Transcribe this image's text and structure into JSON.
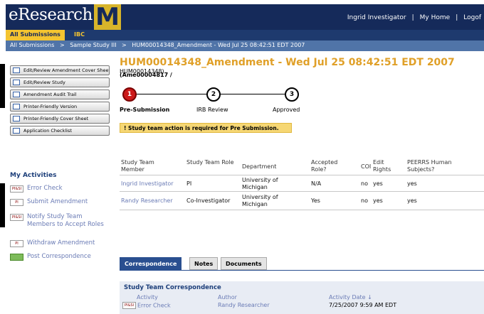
{
  "header": {
    "logo_text": "eResearch",
    "logo_mark": "M",
    "user_name": "Ingrid Investigator",
    "separator": "|",
    "my_home": "My Home",
    "logoff": "Logof"
  },
  "tabbar": {
    "all_submissions": "All Submissions",
    "irb": "IBC"
  },
  "breadcrumb": {
    "items": [
      "All Submissions",
      ">",
      "Sample Study III",
      ">",
      "HUM00014348_Amendment - Wed Jul 25 08:42:51 EDT 2007"
    ]
  },
  "sidebar": {
    "buttons": [
      "Edit/Review Amendment Cover Sheet",
      "Edit/Review Study",
      "Amendment Audit Trail",
      "Printer-Friendly Version",
      "Printer-Friendly Cover Sheet",
      "Application Checklist"
    ],
    "activities_title": "My Activities",
    "activities": [
      {
        "badge": "PI&SI",
        "label": "Error Check"
      },
      {
        "badge": "PI",
        "label": "Submit Amendment"
      },
      {
        "badge": "PI&SI",
        "label": "Notify Study Team Members to Accept Roles"
      },
      {
        "badge": "PI",
        "label": "Withdraw Amendment"
      },
      {
        "badge": "",
        "label": "Post Correspondence"
      }
    ]
  },
  "main": {
    "title": "HUM00014348_Amendment - Wed Jul 25 08:42:51 EDT 2007",
    "ids_inline": "(Ame00004817 /",
    "ids_line2": "HUM00014348)",
    "steps": [
      {
        "num": "1",
        "label": "Pre-Submission"
      },
      {
        "num": "2",
        "label": "IRB Review"
      },
      {
        "num": "3",
        "label": "Approved"
      }
    ],
    "warning_icon": "!",
    "warning": "Study team action is required for Pre Submission."
  },
  "team_table": {
    "headers": [
      "Study Team Member",
      "Study Team Role",
      "Department",
      "Accepted Role?",
      "COI",
      "Edit Rights",
      "PEERRS Human Subjects?"
    ],
    "rows": [
      [
        "Ingrid Investigator",
        "PI",
        "University of Michigan",
        "N/A",
        "no",
        "yes",
        "yes"
      ],
      [
        "Randy Researcher",
        "Co-Investigator",
        "University of Michigan",
        "Yes",
        "no",
        "yes",
        "yes"
      ]
    ]
  },
  "panel_tabs": [
    "Correspondence",
    "Notes",
    "Documents"
  ],
  "correspondence": {
    "title": "Study Team Correspondence",
    "headers": [
      "Activity",
      "Author",
      "Activity Date"
    ],
    "sort_indicator": "↓",
    "rows": [
      {
        "badge": "PI&SI",
        "activity": "Error Check",
        "author": "Randy Researcher",
        "date": "7/25/2007 9:59 AM EDT"
      }
    ]
  }
}
